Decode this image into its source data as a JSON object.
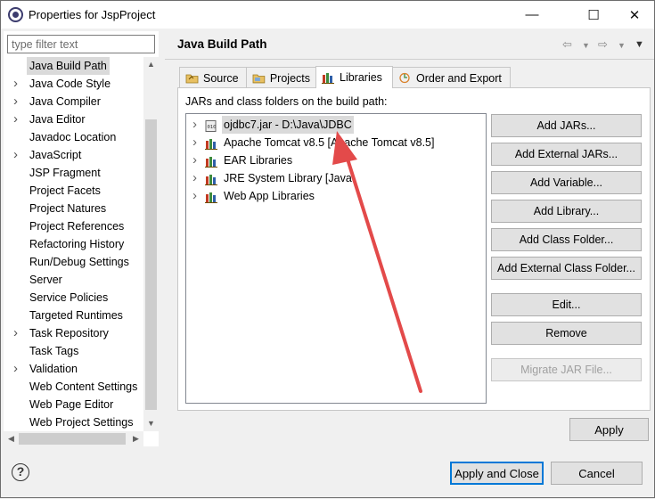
{
  "window": {
    "title": "Properties for JspProject"
  },
  "titlebar_buttons": {
    "minimize": "—",
    "maximize": "☐",
    "close": "✕"
  },
  "filter": {
    "placeholder": "type filter text",
    "value": ""
  },
  "nav": {
    "items": [
      {
        "label": "Java Build Path",
        "expandable": false,
        "selected": true
      },
      {
        "label": "Java Code Style",
        "expandable": true
      },
      {
        "label": "Java Compiler",
        "expandable": true
      },
      {
        "label": "Java Editor",
        "expandable": true
      },
      {
        "label": "Javadoc Location",
        "expandable": false
      },
      {
        "label": "JavaScript",
        "expandable": true
      },
      {
        "label": "JSP Fragment",
        "expandable": false
      },
      {
        "label": "Project Facets",
        "expandable": false
      },
      {
        "label": "Project Natures",
        "expandable": false
      },
      {
        "label": "Project References",
        "expandable": false
      },
      {
        "label": "Refactoring History",
        "expandable": false
      },
      {
        "label": "Run/Debug Settings",
        "expandable": false
      },
      {
        "label": "Server",
        "expandable": false
      },
      {
        "label": "Service Policies",
        "expandable": false
      },
      {
        "label": "Targeted Runtimes",
        "expandable": false
      },
      {
        "label": "Task Repository",
        "expandable": true
      },
      {
        "label": "Task Tags",
        "expandable": false
      },
      {
        "label": "Validation",
        "expandable": true
      },
      {
        "label": "Web Content Settings",
        "expandable": false
      },
      {
        "label": "Web Page Editor",
        "expandable": false
      },
      {
        "label": "Web Project Settings",
        "expandable": false
      }
    ]
  },
  "page": {
    "title": "Java Build Path"
  },
  "tabs": [
    {
      "label": "Source",
      "icon": "source-folder-icon",
      "active": false
    },
    {
      "label": "Projects",
      "icon": "projects-folder-icon",
      "active": false
    },
    {
      "label": "Libraries",
      "icon": "libraries-icon",
      "active": true
    },
    {
      "label": "Order and Export",
      "icon": "order-export-icon",
      "active": false
    }
  ],
  "libraries": {
    "label": "JARs and class folders on the build path:",
    "entries": [
      {
        "label": "ojdbc7.jar - D:\\Java\\JDBC",
        "icon": "jar-icon",
        "selected": true
      },
      {
        "label": "Apache Tomcat v8.5 [Apache Tomcat v8.5]",
        "icon": "library-icon",
        "selected": false
      },
      {
        "label": "EAR Libraries",
        "icon": "library-icon",
        "selected": false
      },
      {
        "label": "JRE System Library [Java",
        "icon": "library-icon",
        "selected": false
      },
      {
        "label": "Web App Libraries",
        "icon": "library-icon",
        "selected": false
      }
    ],
    "buttons": [
      {
        "label": "Add JARs...",
        "enabled": true
      },
      {
        "label": "Add External JARs...",
        "enabled": true
      },
      {
        "label": "Add Variable...",
        "enabled": true
      },
      {
        "label": "Add Library...",
        "enabled": true
      },
      {
        "label": "Add Class Folder...",
        "enabled": true
      },
      {
        "label": "Add External Class Folder...",
        "enabled": true
      },
      {
        "label": "Edit...",
        "enabled": true
      },
      {
        "label": "Remove",
        "enabled": true
      },
      {
        "label": "Migrate JAR File...",
        "enabled": false
      }
    ]
  },
  "actions": {
    "apply": "Apply",
    "apply_close": "Apply and Close",
    "cancel": "Cancel"
  },
  "colors": {
    "annotation_arrow": "#e34a4a",
    "selection": "#dadada",
    "default_button_border": "#0078d7"
  }
}
